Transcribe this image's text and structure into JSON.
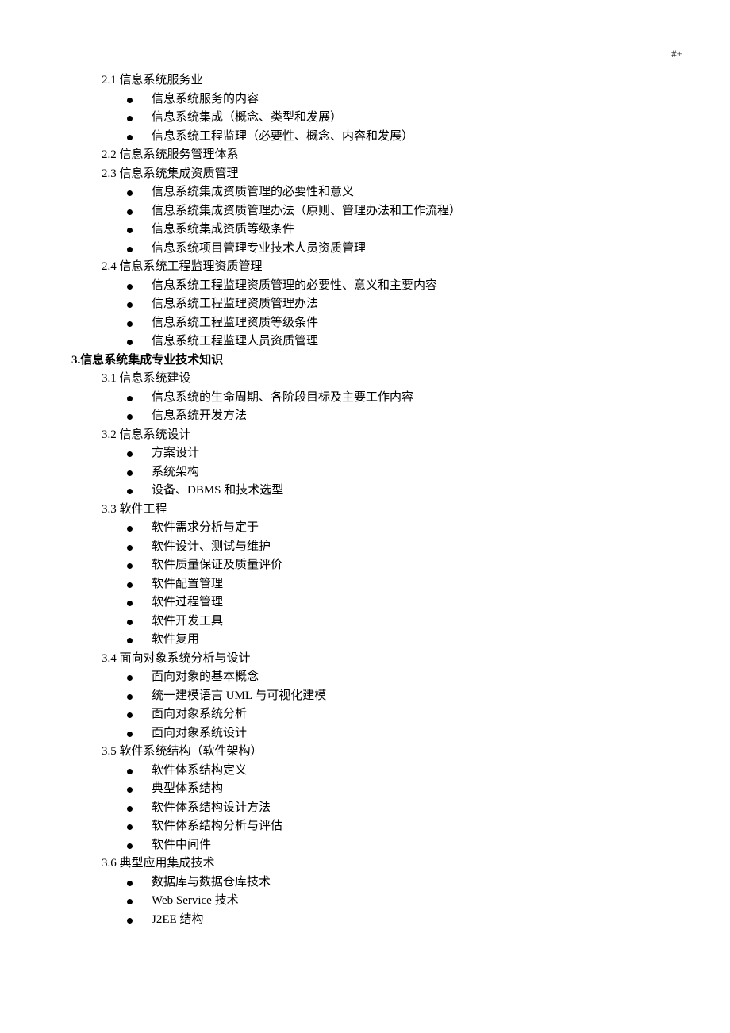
{
  "page_mark": "#+",
  "sections": [
    {
      "label": "2.1 信息系统服务业",
      "bullets": [
        "信息系统服务的内容",
        "信息系统集成（概念、类型和发展）",
        "信息系统工程监理（必要性、概念、内容和发展）"
      ]
    },
    {
      "label": "2.2 信息系统服务管理体系",
      "bullets": []
    },
    {
      "label": "2.3 信息系统集成资质管理",
      "bullets": [
        "信息系统集成资质管理的必要性和意义",
        "信息系统集成资质管理办法（原则、管理办法和工作流程）",
        "信息系统集成资质等级条件",
        "信息系统项目管理专业技术人员资质管理"
      ]
    },
    {
      "label": "2.4 信息系统工程监理资质管理",
      "bullets": [
        "信息系统工程监理资质管理的必要性、意义和主要内容",
        "信息系统工程监理资质管理办法",
        "信息系统工程监理资质等级条件",
        "信息系统工程监理人员资质管理"
      ]
    }
  ],
  "heading": "3.信息系统集成专业技术知识",
  "sections2": [
    {
      "label": "3.1 信息系统建设",
      "bullets": [
        "信息系统的生命周期、各阶段目标及主要工作内容",
        "信息系统开发方法"
      ]
    },
    {
      "label": "3.2 信息系统设计",
      "bullets": [
        "方案设计",
        "系统架构",
        "设备、DBMS 和技术选型"
      ]
    },
    {
      "label": "3.3 软件工程",
      "bullets": [
        "软件需求分析与定于",
        "软件设计、测试与维护",
        "软件质量保证及质量评价",
        "软件配置管理",
        "软件过程管理",
        "软件开发工具",
        "软件复用"
      ]
    },
    {
      "label": "3.4 面向对象系统分析与设计",
      "bullets": [
        "面向对象的基本概念",
        "统一建模语言 UML 与可视化建模",
        "面向对象系统分析",
        "面向对象系统设计"
      ]
    },
    {
      "label": "3.5 软件系统结构（软件架构）",
      "bullets": [
        "软件体系结构定义",
        "典型体系结构",
        "软件体系结构设计方法",
        "软件体系结构分析与评估",
        "软件中间件"
      ]
    },
    {
      "label": "3.6 典型应用集成技术",
      "bullets": [
        "数据库与数据仓库技术",
        "Web Service 技术",
        "J2EE 结构"
      ]
    }
  ]
}
